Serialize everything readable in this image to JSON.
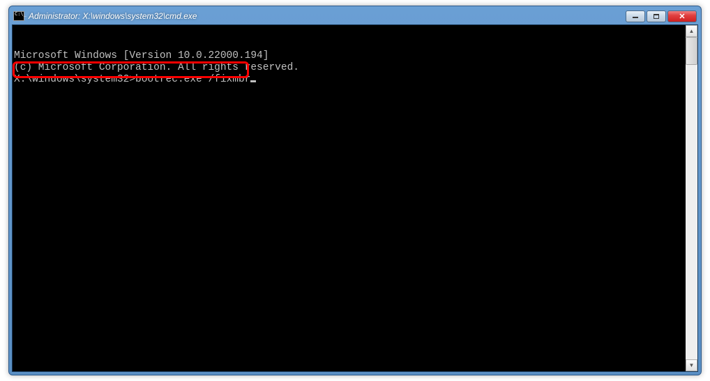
{
  "window": {
    "title": "Administrator: X:\\windows\\system32\\cmd.exe"
  },
  "console": {
    "line1": "Microsoft Windows [Version 10.0.22000.194]",
    "line2": "(c) Microsoft Corporation. All rights reserved.",
    "blank": "",
    "prompt": "X:\\windows\\system32>",
    "command": "bootrec.exe /fixmbr"
  }
}
